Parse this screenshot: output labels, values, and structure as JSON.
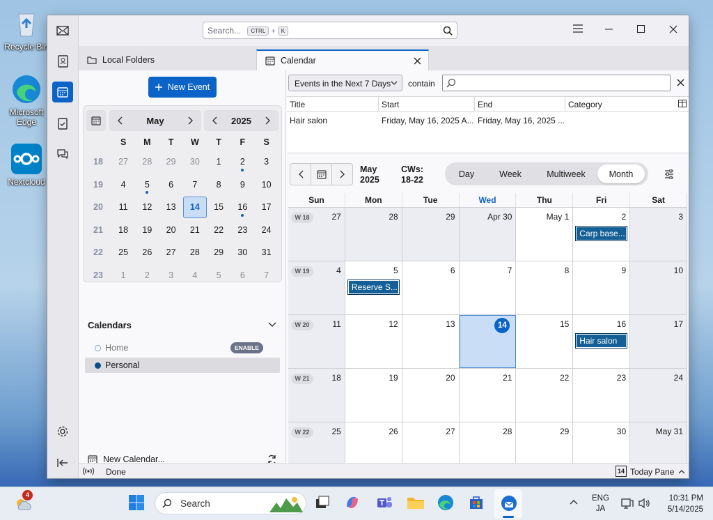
{
  "desktop": {
    "icons": [
      "Recycle Bin",
      "Microsoft Edge",
      "Nextcloud"
    ]
  },
  "app": {
    "search_placeholder": "Search...",
    "shortcut_keys": [
      "CTRL",
      "+",
      "K"
    ],
    "tabs": [
      "Local Folders",
      "Calendar"
    ],
    "new_event": "New Event",
    "minical": {
      "month": "May",
      "year": "2025",
      "weekdays": [
        "S",
        "M",
        "T",
        "W",
        "T",
        "F",
        "S"
      ],
      "weeks": [
        {
          "wk": "18",
          "days": [
            "27",
            "28",
            "29",
            "30",
            "1",
            "2",
            "3"
          ]
        },
        {
          "wk": "19",
          "days": [
            "4",
            "5",
            "6",
            "7",
            "8",
            "9",
            "10"
          ]
        },
        {
          "wk": "20",
          "days": [
            "11",
            "12",
            "13",
            "14",
            "15",
            "16",
            "17"
          ]
        },
        {
          "wk": "21",
          "days": [
            "18",
            "19",
            "20",
            "21",
            "22",
            "23",
            "24"
          ]
        },
        {
          "wk": "22",
          "days": [
            "25",
            "26",
            "27",
            "28",
            "29",
            "30",
            "31"
          ]
        },
        {
          "wk": "23",
          "days": [
            "1",
            "2",
            "3",
            "4",
            "5",
            "6",
            "7"
          ]
        }
      ]
    },
    "calendars": {
      "title": "Calendars",
      "items": [
        {
          "name": "Home",
          "badge": "ENABLE"
        },
        {
          "name": "Personal"
        }
      ],
      "new_calendar": "New Calendar..."
    },
    "filter": {
      "dropdown": "Events in the Next 7 Days",
      "contain": "contain"
    },
    "event_list": {
      "columns": [
        "Title",
        "Start",
        "End",
        "Category"
      ],
      "rows": [
        {
          "title": "Hair salon",
          "start": "Friday, May 16, 2025 A...",
          "end": "Friday, May 16, 2025 ...",
          "category": ""
        }
      ]
    },
    "month_view": {
      "label_month": "May",
      "label_year": "2025",
      "cws_label": "CWs:",
      "cws_range": "18-22",
      "views": [
        "Day",
        "Week",
        "Multiweek",
        "Month"
      ],
      "selected_view": "Month",
      "weekday_headers": [
        "Sun",
        "Mon",
        "Tue",
        "Wed",
        "Thu",
        "Fri",
        "Sat"
      ],
      "weeks": [
        {
          "wk": "W 18",
          "days": [
            "27",
            "28",
            "29",
            "Apr 30",
            "May 1",
            "2",
            "3"
          ]
        },
        {
          "wk": "W 19",
          "days": [
            "4",
            "5",
            "6",
            "7",
            "8",
            "9",
            "10"
          ]
        },
        {
          "wk": "W 20",
          "days": [
            "11",
            "12",
            "13",
            "14",
            "15",
            "16",
            "17"
          ]
        },
        {
          "wk": "W 21",
          "days": [
            "18",
            "19",
            "20",
            "21",
            "22",
            "23",
            "24"
          ]
        },
        {
          "wk": "W 22",
          "days": [
            "25",
            "26",
            "27",
            "28",
            "29",
            "30",
            "May 31"
          ]
        }
      ],
      "events": [
        "Carp base...",
        "Reserve S...",
        "Hair salon"
      ]
    },
    "status": {
      "text": "Done",
      "today_pane": "Today Pane",
      "today_num": "14"
    }
  },
  "taskbar": {
    "weather_badge": "4",
    "search": "Search",
    "lang1": "ENG",
    "lang2": "JA",
    "time": "10:31 PM",
    "date": "5/14/2025"
  },
  "colors": {
    "accent": "#0b63c8",
    "event": "#135f96",
    "today_bg": "#c9def6"
  }
}
